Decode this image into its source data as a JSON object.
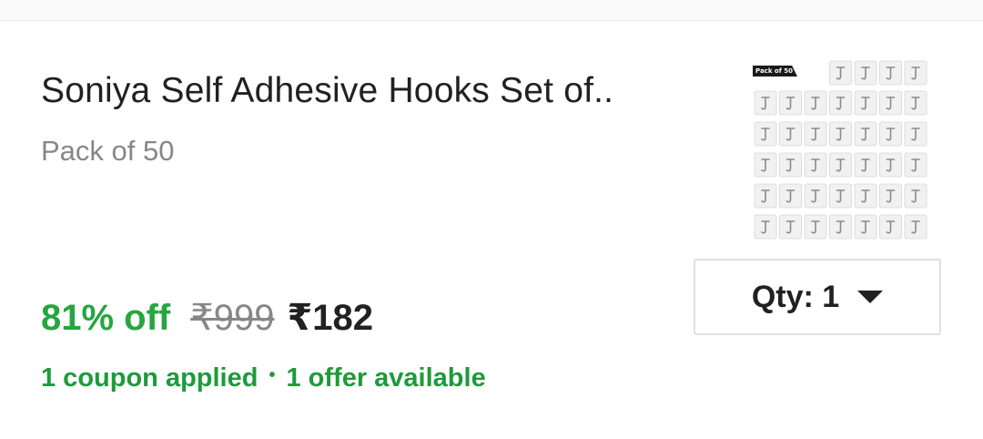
{
  "product": {
    "title": "Soniya Self Adhesive Hooks Set of..",
    "variant": "Pack of 50",
    "thumbnail_badge": "Pack of 50",
    "thumbnail_icon": "adhesive-hook-icon"
  },
  "quantity": {
    "label": "Qty: 1"
  },
  "pricing": {
    "discount": "81% off",
    "mrp": "₹999",
    "price": "₹182"
  },
  "offers": {
    "coupons": "1 coupon applied",
    "separator": "•",
    "offers": "1 offer available"
  },
  "colors": {
    "discount_green": "#26a541",
    "offer_green": "#1f9a3a",
    "text_primary": "#212121",
    "text_secondary": "#878787"
  }
}
